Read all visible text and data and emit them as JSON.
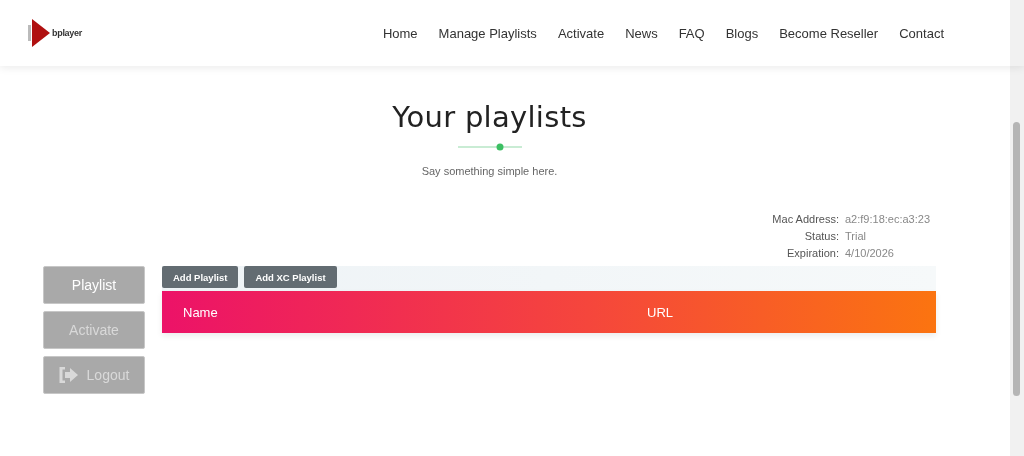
{
  "logo": {
    "text": "bplayer"
  },
  "nav": [
    {
      "label": "Home"
    },
    {
      "label": "Manage Playlists"
    },
    {
      "label": "Activate"
    },
    {
      "label": "News"
    },
    {
      "label": "FAQ"
    },
    {
      "label": "Blogs"
    },
    {
      "label": "Become Reseller"
    },
    {
      "label": "Contact"
    }
  ],
  "heading": {
    "title": "Your playlists",
    "subtitle": "Say something simple here."
  },
  "device_info": [
    {
      "label": "Mac Address:",
      "value": "a2:f9:18:ec:a3:23"
    },
    {
      "label": "Status:",
      "value": "Trial"
    },
    {
      "label": "Expiration:",
      "value": "4/10/2026"
    }
  ],
  "sidebar": {
    "items": [
      {
        "label": "Playlist",
        "selected": true,
        "kind": "plain"
      },
      {
        "label": "Activate",
        "selected": false,
        "kind": "plain"
      },
      {
        "label": "Logout",
        "selected": false,
        "kind": "logout"
      }
    ]
  },
  "toolbar": {
    "buttons": [
      "Add Playlist",
      "Add XC Playlist"
    ]
  },
  "table": {
    "columns": [
      "Name",
      "URL"
    ]
  }
}
